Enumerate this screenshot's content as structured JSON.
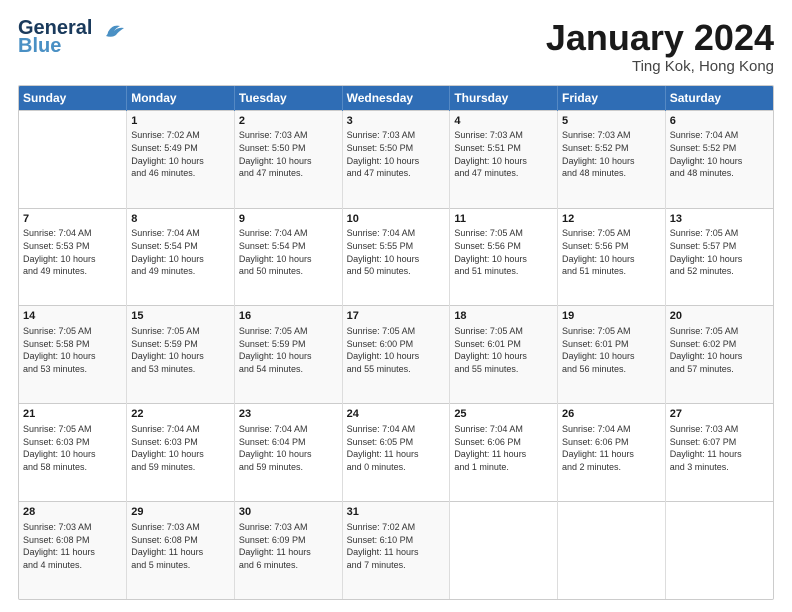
{
  "header": {
    "logo_general": "General",
    "logo_blue": "Blue",
    "month_title": "January 2024",
    "location": "Ting Kok, Hong Kong"
  },
  "days_of_week": [
    "Sunday",
    "Monday",
    "Tuesday",
    "Wednesday",
    "Thursday",
    "Friday",
    "Saturday"
  ],
  "weeks": [
    [
      {
        "num": "",
        "info": ""
      },
      {
        "num": "1",
        "info": "Sunrise: 7:02 AM\nSunset: 5:49 PM\nDaylight: 10 hours\nand 46 minutes."
      },
      {
        "num": "2",
        "info": "Sunrise: 7:03 AM\nSunset: 5:50 PM\nDaylight: 10 hours\nand 47 minutes."
      },
      {
        "num": "3",
        "info": "Sunrise: 7:03 AM\nSunset: 5:50 PM\nDaylight: 10 hours\nand 47 minutes."
      },
      {
        "num": "4",
        "info": "Sunrise: 7:03 AM\nSunset: 5:51 PM\nDaylight: 10 hours\nand 47 minutes."
      },
      {
        "num": "5",
        "info": "Sunrise: 7:03 AM\nSunset: 5:52 PM\nDaylight: 10 hours\nand 48 minutes."
      },
      {
        "num": "6",
        "info": "Sunrise: 7:04 AM\nSunset: 5:52 PM\nDaylight: 10 hours\nand 48 minutes."
      }
    ],
    [
      {
        "num": "7",
        "info": "Sunrise: 7:04 AM\nSunset: 5:53 PM\nDaylight: 10 hours\nand 49 minutes."
      },
      {
        "num": "8",
        "info": "Sunrise: 7:04 AM\nSunset: 5:54 PM\nDaylight: 10 hours\nand 49 minutes."
      },
      {
        "num": "9",
        "info": "Sunrise: 7:04 AM\nSunset: 5:54 PM\nDaylight: 10 hours\nand 50 minutes."
      },
      {
        "num": "10",
        "info": "Sunrise: 7:04 AM\nSunset: 5:55 PM\nDaylight: 10 hours\nand 50 minutes."
      },
      {
        "num": "11",
        "info": "Sunrise: 7:05 AM\nSunset: 5:56 PM\nDaylight: 10 hours\nand 51 minutes."
      },
      {
        "num": "12",
        "info": "Sunrise: 7:05 AM\nSunset: 5:56 PM\nDaylight: 10 hours\nand 51 minutes."
      },
      {
        "num": "13",
        "info": "Sunrise: 7:05 AM\nSunset: 5:57 PM\nDaylight: 10 hours\nand 52 minutes."
      }
    ],
    [
      {
        "num": "14",
        "info": "Sunrise: 7:05 AM\nSunset: 5:58 PM\nDaylight: 10 hours\nand 53 minutes."
      },
      {
        "num": "15",
        "info": "Sunrise: 7:05 AM\nSunset: 5:59 PM\nDaylight: 10 hours\nand 53 minutes."
      },
      {
        "num": "16",
        "info": "Sunrise: 7:05 AM\nSunset: 5:59 PM\nDaylight: 10 hours\nand 54 minutes."
      },
      {
        "num": "17",
        "info": "Sunrise: 7:05 AM\nSunset: 6:00 PM\nDaylight: 10 hours\nand 55 minutes."
      },
      {
        "num": "18",
        "info": "Sunrise: 7:05 AM\nSunset: 6:01 PM\nDaylight: 10 hours\nand 55 minutes."
      },
      {
        "num": "19",
        "info": "Sunrise: 7:05 AM\nSunset: 6:01 PM\nDaylight: 10 hours\nand 56 minutes."
      },
      {
        "num": "20",
        "info": "Sunrise: 7:05 AM\nSunset: 6:02 PM\nDaylight: 10 hours\nand 57 minutes."
      }
    ],
    [
      {
        "num": "21",
        "info": "Sunrise: 7:05 AM\nSunset: 6:03 PM\nDaylight: 10 hours\nand 58 minutes."
      },
      {
        "num": "22",
        "info": "Sunrise: 7:04 AM\nSunset: 6:03 PM\nDaylight: 10 hours\nand 59 minutes."
      },
      {
        "num": "23",
        "info": "Sunrise: 7:04 AM\nSunset: 6:04 PM\nDaylight: 10 hours\nand 59 minutes."
      },
      {
        "num": "24",
        "info": "Sunrise: 7:04 AM\nSunset: 6:05 PM\nDaylight: 11 hours\nand 0 minutes."
      },
      {
        "num": "25",
        "info": "Sunrise: 7:04 AM\nSunset: 6:06 PM\nDaylight: 11 hours\nand 1 minute."
      },
      {
        "num": "26",
        "info": "Sunrise: 7:04 AM\nSunset: 6:06 PM\nDaylight: 11 hours\nand 2 minutes."
      },
      {
        "num": "27",
        "info": "Sunrise: 7:03 AM\nSunset: 6:07 PM\nDaylight: 11 hours\nand 3 minutes."
      }
    ],
    [
      {
        "num": "28",
        "info": "Sunrise: 7:03 AM\nSunset: 6:08 PM\nDaylight: 11 hours\nand 4 minutes."
      },
      {
        "num": "29",
        "info": "Sunrise: 7:03 AM\nSunset: 6:08 PM\nDaylight: 11 hours\nand 5 minutes."
      },
      {
        "num": "30",
        "info": "Sunrise: 7:03 AM\nSunset: 6:09 PM\nDaylight: 11 hours\nand 6 minutes."
      },
      {
        "num": "31",
        "info": "Sunrise: 7:02 AM\nSunset: 6:10 PM\nDaylight: 11 hours\nand 7 minutes."
      },
      {
        "num": "",
        "info": ""
      },
      {
        "num": "",
        "info": ""
      },
      {
        "num": "",
        "info": ""
      }
    ]
  ]
}
